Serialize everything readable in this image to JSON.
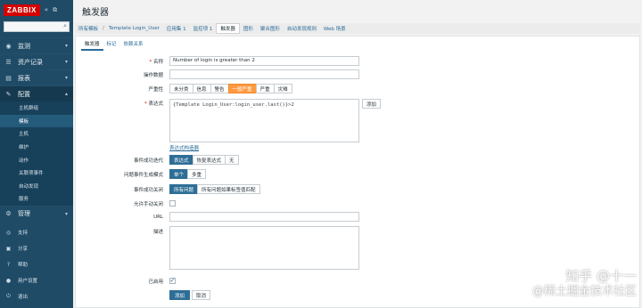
{
  "app": {
    "logo": "ZABBIX",
    "page_title": "触发器"
  },
  "sidebar": {
    "collapse_icon": "«",
    "fullscreen_icon": "⧉",
    "search_placeholder": "",
    "menu": [
      {
        "label": "监测",
        "icon": "eye-icon"
      },
      {
        "label": "资产记录",
        "icon": "list-icon"
      },
      {
        "label": "报表",
        "icon": "chart-icon"
      },
      {
        "label": "配置",
        "icon": "wrench-icon"
      }
    ],
    "config_items": [
      "主机群组",
      "模板",
      "主机",
      "维护",
      "动作",
      "关联项事件",
      "自动发现",
      "服务"
    ],
    "admin": {
      "label": "管理",
      "icon": "gear-icon"
    },
    "bottom": [
      {
        "label": "支持",
        "icon": "support-icon"
      },
      {
        "label": "分享",
        "icon": "share-icon"
      },
      {
        "label": "帮助",
        "icon": "help-icon"
      },
      {
        "label": "用户设置",
        "icon": "user-icon"
      },
      {
        "label": "退出",
        "icon": "power-icon"
      }
    ]
  },
  "breadcrumb": {
    "all_templates": "所有模板",
    "sep": "/",
    "template": "Template Login_User",
    "items": [
      "应用集 1",
      "监控项 1",
      "触发器",
      "图形",
      "聚合图形",
      "自动发现规则",
      "Web 场景"
    ],
    "current": "触发器"
  },
  "tabs": [
    "触发器",
    "标记",
    "依赖关系"
  ],
  "form": {
    "name_label": "名称",
    "name_value": "Number of login is greater than 2",
    "opdata_label": "操作数据",
    "opdata_value": "",
    "severity_label": "严重性",
    "severity_options": [
      "未分类",
      "信息",
      "警告",
      "一般严重",
      "严重",
      "灾难"
    ],
    "severity_selected": "一般严重",
    "expression_label": "表达式",
    "expression_value": "{Template Login_User:login_user.last()}>2",
    "add_label": "添加",
    "constructor_link": "表达式构造器",
    "ok_event_label": "事件成功迭代",
    "ok_event_options": [
      "表达式",
      "恢复表达式",
      "无"
    ],
    "ok_event_selected": "表达式",
    "problem_mode_label": "问题事件生成模式",
    "problem_mode_options": [
      "单个",
      "多重"
    ],
    "problem_mode_selected": "单个",
    "ok_close_label": "事件成功关闭",
    "ok_close_options": [
      "所有问题",
      "所有问题如果标签值匹配"
    ],
    "ok_close_selected": "所有问题",
    "manual_close_label": "允许手动关闭",
    "url_label": "URL",
    "url_value": "",
    "desc_label": "描述",
    "desc_value": "",
    "enabled_label": "已启用",
    "submit_label": "添加",
    "cancel_label": "取消"
  },
  "watermark": {
    "line1": "知乎 @十一",
    "line2": "@稀土掘金技术社区"
  },
  "colors": {
    "sidebar": "#1f4b67",
    "accent": "#2d6e96",
    "severity_average": "#ff9a40",
    "logo": "#d40000"
  }
}
